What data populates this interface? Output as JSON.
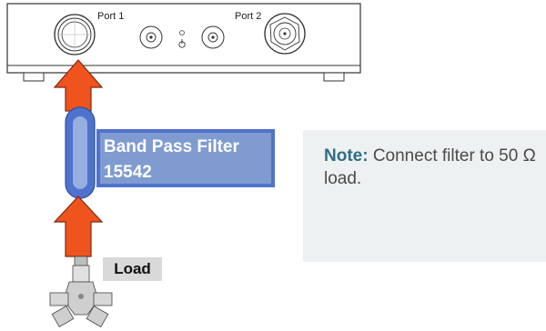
{
  "instrument": {
    "port1_label": "Port 1",
    "port2_label": "Port 2"
  },
  "filter": {
    "line1": "Band Pass Filter",
    "line2": "15542"
  },
  "note": {
    "label": "Note:",
    "text": "Connect filter to 50 Ω load."
  },
  "load": {
    "label": "Load"
  },
  "colors": {
    "arrow": "#f0541e",
    "arrow_outline": "#7a2a10",
    "filter_fill": "#7f9bd0",
    "filter_border": "#4f73cc",
    "note_bg": "#eef1f1",
    "note_label": "#2f6e86"
  }
}
